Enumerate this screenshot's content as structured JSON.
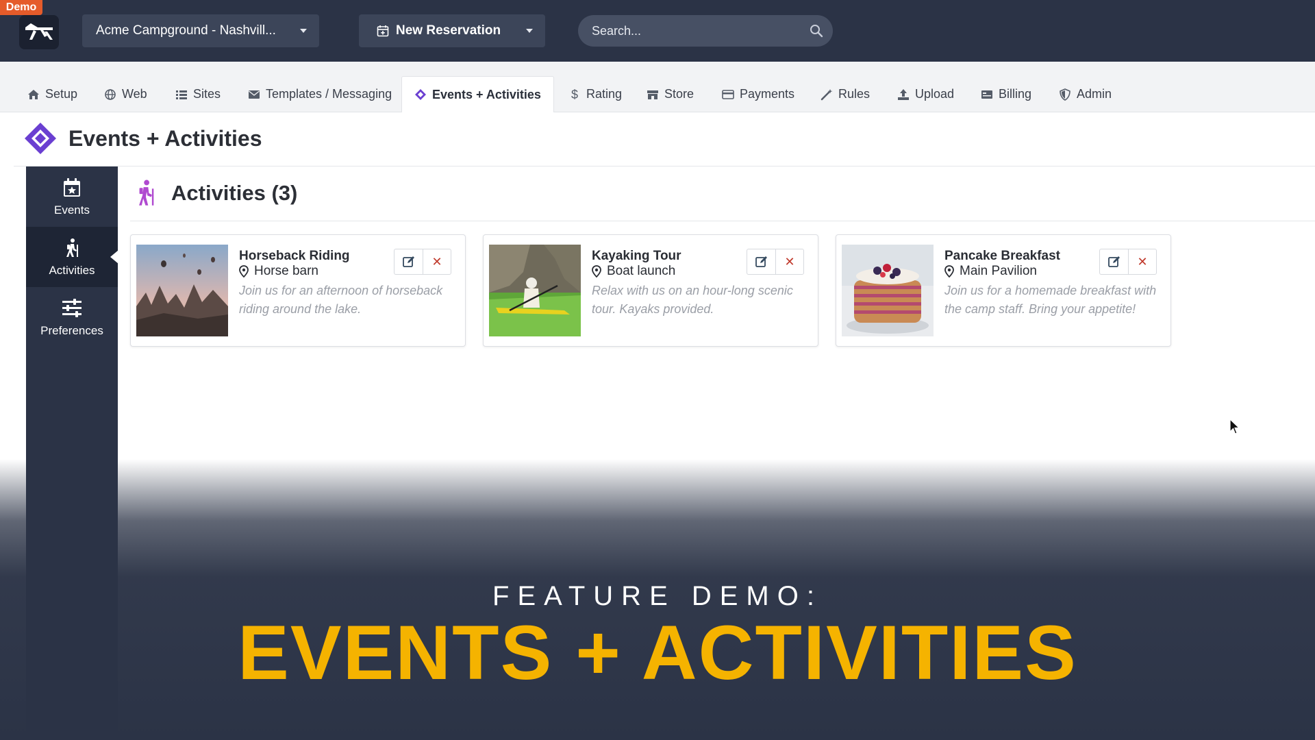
{
  "badge": "Demo",
  "topbar": {
    "campground": "Acme Campground - Nashvill...",
    "new_reservation": "New Reservation",
    "search_placeholder": "Search..."
  },
  "nav": {
    "tabs": [
      {
        "label": "Setup",
        "icon": "home-icon"
      },
      {
        "label": "Web",
        "icon": "globe-icon"
      },
      {
        "label": "Sites",
        "icon": "list-icon"
      },
      {
        "label": "Templates / Messaging",
        "icon": "envelope-icon"
      },
      {
        "label": "Events + Activities",
        "icon": "ticket-icon",
        "active": true
      },
      {
        "label": "Rating",
        "icon": "dollar-icon"
      },
      {
        "label": "Store",
        "icon": "store-icon"
      },
      {
        "label": "Payments",
        "icon": "credit-card-icon"
      },
      {
        "label": "Rules",
        "icon": "magic-wand-icon"
      },
      {
        "label": "Upload",
        "icon": "upload-icon"
      },
      {
        "label": "Billing",
        "icon": "billing-icon"
      },
      {
        "label": "Admin",
        "icon": "shield-icon"
      }
    ]
  },
  "page": {
    "title": "Events + Activities"
  },
  "sidebar": {
    "items": [
      {
        "label": "Events",
        "icon": "calendar-star-icon"
      },
      {
        "label": "Activities",
        "icon": "hiking-icon",
        "active": true
      },
      {
        "label": "Preferences",
        "icon": "sliders-icon"
      }
    ]
  },
  "main": {
    "section_title": "Activities (3)",
    "cards": [
      {
        "title": "Horseback Riding",
        "location": "Horse barn",
        "description": "Join us for an afternoon of horseback riding around the lake.",
        "image": "balloons-landscape-photo"
      },
      {
        "title": "Kayaking Tour",
        "location": "Boat launch",
        "description": "Relax with us on an hour-long scenic tour. Kayaks provided.",
        "image": "kayak-photo"
      },
      {
        "title": "Pancake Breakfast",
        "location": "Main Pavilion",
        "description": "Join us for a homemade breakfast with the camp staff. Bring your appetite!",
        "image": "pancake-photo"
      }
    ]
  },
  "overlay": {
    "subtitle": "FEATURE DEMO:",
    "title": "EVENTS + ACTIVITIES"
  },
  "colors": {
    "topbar": "#2b3346",
    "accent_purple": "#6a3fd1",
    "overlay_title": "#f5b300",
    "delete_red": "#c0392b"
  }
}
